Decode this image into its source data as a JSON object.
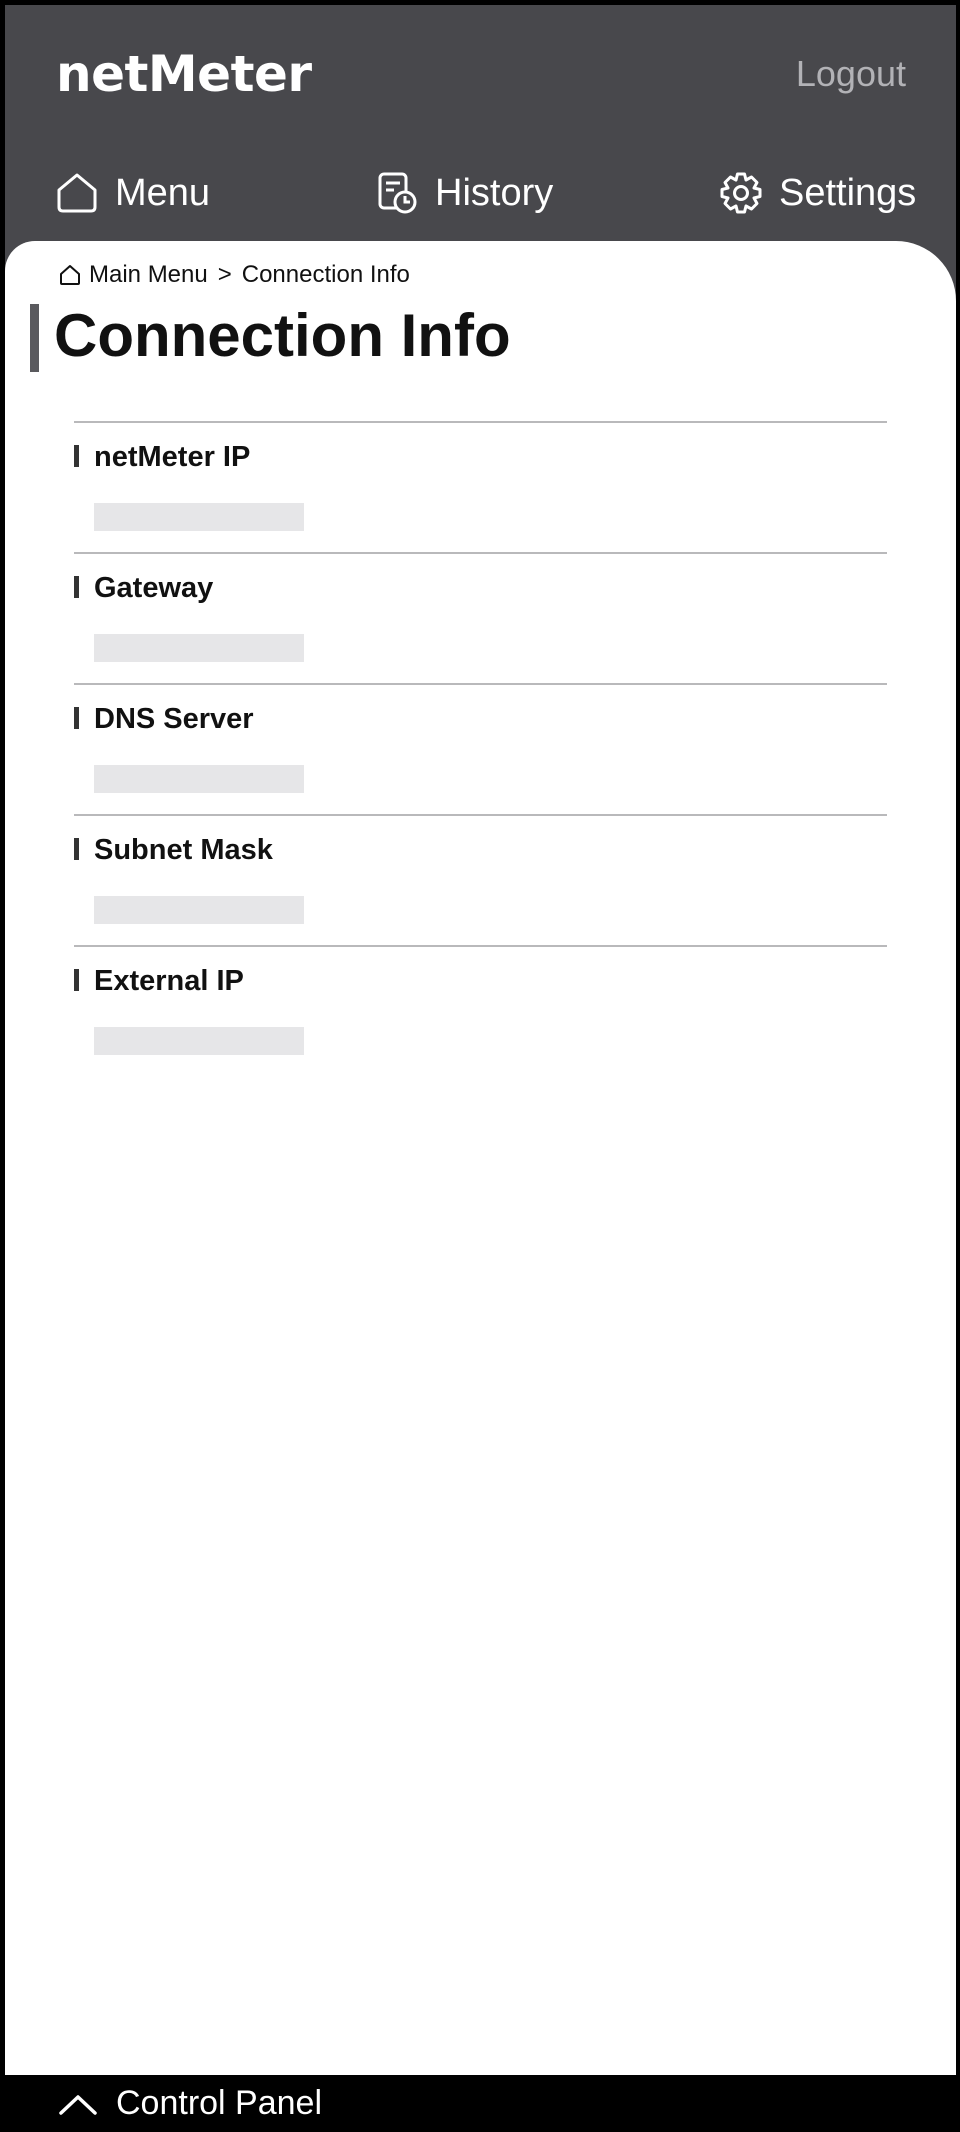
{
  "header": {
    "brand": "netMeter",
    "logout_label": "Logout"
  },
  "nav": [
    {
      "label": "Menu",
      "icon": "home-icon"
    },
    {
      "label": "History",
      "icon": "history-icon"
    },
    {
      "label": "Settings",
      "icon": "gear-icon"
    }
  ],
  "breadcrumb": {
    "icon": "home-icon",
    "items": [
      "Main Menu",
      "Connection Info"
    ],
    "separator": ">"
  },
  "page": {
    "title": "Connection Info"
  },
  "fields": [
    {
      "label": "netMeter IP",
      "value": ""
    },
    {
      "label": "Gateway",
      "value": ""
    },
    {
      "label": "DNS Server",
      "value": ""
    },
    {
      "label": "Subnet Mask",
      "value": ""
    },
    {
      "label": "External IP",
      "value": ""
    }
  ],
  "footer": {
    "label": "Control Panel",
    "icon": "chevron-up-icon"
  },
  "colors": {
    "header_bg": "#48484c",
    "content_bg": "#ffffff",
    "value_placeholder_bg": "#e6e6e8",
    "logout_text": "#b2b2b6",
    "footer_bg": "#000000"
  }
}
